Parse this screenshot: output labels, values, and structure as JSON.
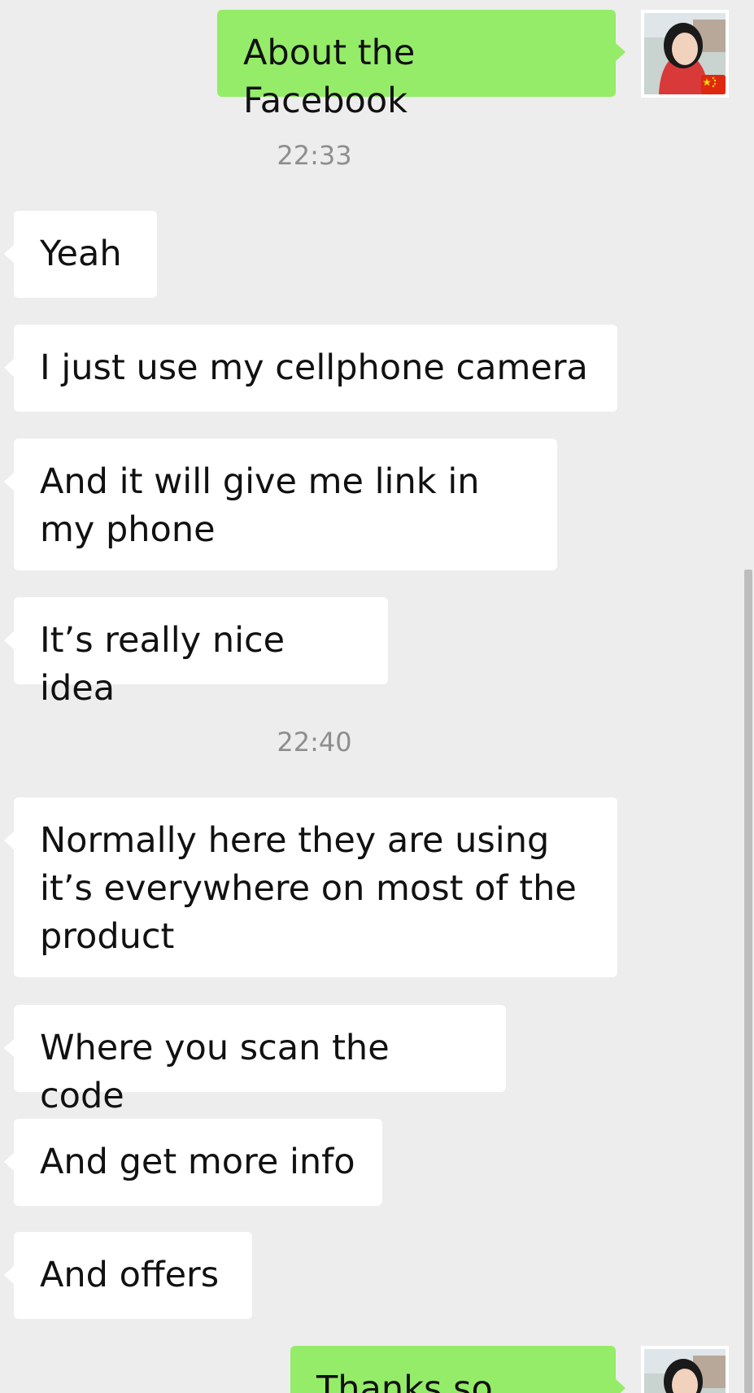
{
  "messages": [
    {
      "sender": "me",
      "text": "About the Facebook"
    },
    {
      "timestamp": "22:33"
    },
    {
      "sender": "other",
      "text": "Yeah"
    },
    {
      "sender": "other",
      "text": "I just use my cellphone camera"
    },
    {
      "sender": "other",
      "text": "And it will give me link in my phone"
    },
    {
      "sender": "other",
      "text": "It’s really nice idea"
    },
    {
      "timestamp": "22:40"
    },
    {
      "sender": "other",
      "text": "Normally here they are using it’s everywhere on most of the product"
    },
    {
      "sender": "other",
      "text": "Where you scan the code"
    },
    {
      "sender": "other",
      "text": "And get more info"
    },
    {
      "sender": "other",
      "text": "And offers"
    },
    {
      "sender": "me",
      "text": "Thanks so much"
    }
  ],
  "colors": {
    "background": "#ededed",
    "outgoing_bubble": "#95ec69",
    "incoming_bubble": "#ffffff",
    "timestamp_text": "#8e8e8e"
  },
  "icons": {
    "avatar": "user-avatar-photo",
    "flag_badge": "china-flag-icon"
  }
}
